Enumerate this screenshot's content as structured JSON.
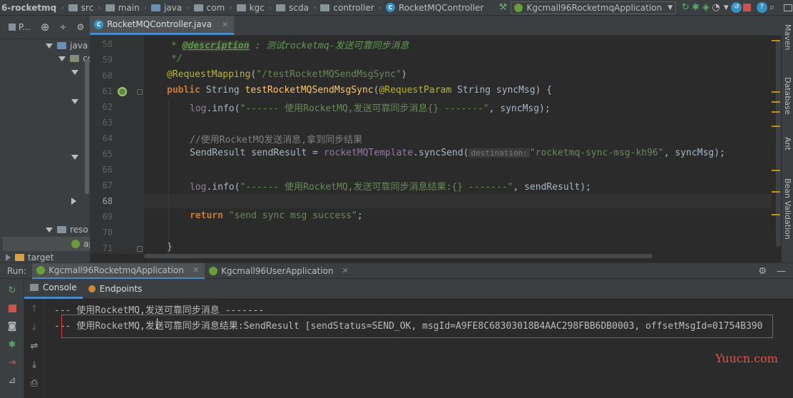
{
  "breadcrumb": {
    "items": [
      "6-rocketmq",
      "src",
      "main",
      "java",
      "com",
      "kgc",
      "scda",
      "controller",
      "RocketMQController"
    ]
  },
  "toolbar": {
    "run_config": "Kgcmall96RocketmqApplication"
  },
  "project_panel": {
    "tab_label": "P...",
    "tree": [
      {
        "label": "java",
        "expanded": true
      },
      {
        "label": "co",
        "expanded": true
      },
      {
        "label": "",
        "expanded": true
      },
      {
        "label": "",
        "expanded": true
      },
      {
        "label": "",
        "expanded": true
      },
      {
        "label": "",
        "expanded": false
      },
      {
        "label": "reso",
        "expanded": true
      },
      {
        "label": "ap",
        "expanded": false
      },
      {
        "label": "target",
        "expanded": false
      }
    ]
  },
  "editor": {
    "tab_label": "RocketMQController.java",
    "lines": [
      {
        "no": "58"
      },
      {
        "no": "59"
      },
      {
        "no": "60"
      },
      {
        "no": "61"
      },
      {
        "no": "62"
      },
      {
        "no": "63"
      },
      {
        "no": "64"
      },
      {
        "no": "65"
      },
      {
        "no": "66"
      },
      {
        "no": "67"
      },
      {
        "no": "68"
      },
      {
        "no": "69"
      },
      {
        "no": "70"
      },
      {
        "no": "71"
      }
    ],
    "code": {
      "l58_star": "* ",
      "l58_tag": "@description",
      "l58_text": " : 测试rocketmq-发送可靠同步消息",
      "l59": "*/",
      "l60_ann": "@RequestMapping",
      "l60_paren": "(",
      "l60_str": "\"/testRocketMQSendMsgSync\"",
      "l60_close": ")",
      "l61_public": "public",
      "l61_type": " String ",
      "l61_method": "testRocketMQSendMsgSync",
      "l61_paren": "(",
      "l61_ann": "@RequestParam",
      "l61_rest": " String syncMsg) {",
      "l62_log": "log",
      "l62_dot": ".info(",
      "l62_str": "\"------ 使用RocketMQ,发送可靠同步消息{} -------\"",
      "l62_rest": ", syncMsg);",
      "l64_cmt": "//使用RocketMQ发送消息,拿到同步结果",
      "l65_a": "SendResult sendResult = ",
      "l65_field": "rocketMQTemplate",
      "l65_b": ".syncSend(",
      "l65_hint": "destination:",
      "l65_str": "\"rocketmq-sync-msg-kh96\"",
      "l65_rest": ", syncMsg);",
      "l67_log": "log",
      "l67_dot": ".info(",
      "l67_str": "\"------ 使用RocketMQ,发送可靠同步消息结果:{} -------\"",
      "l67_rest": ", sendResult);",
      "l69_return": "return",
      "l69_str": " \"send sync msg success\"",
      "l69_semi": ";",
      "l71": "}"
    }
  },
  "right_strip": {
    "maven": "Maven",
    "database": "Database",
    "ant": "Ant",
    "bean_validation": "Bean Validation"
  },
  "run_panel": {
    "label": "Run:",
    "tabs": [
      {
        "label": "Kgcmall96RocketmqApplication",
        "active": true
      },
      {
        "label": "Kgcmall96UserApplication",
        "active": false
      }
    ],
    "subtabs": {
      "console": "Console",
      "endpoints": "Endpoints"
    },
    "console_lines": [
      "--- 使用RocketMQ,发送可靠同步消息 -------",
      "--- 使用RocketMQ,发送可靠同步消息结果:SendResult [sendStatus=SEND_OK, msgId=A9FE8C68303018B4AAC298FBB6DB0003, offsetMsgId=01754B390"
    ]
  },
  "watermark": "Yuucn.com",
  "colors": {
    "highlight_box": "#e0393e",
    "keyword": "#cc7832",
    "string": "#6a8759",
    "accent_tab": "#4a88c7"
  }
}
